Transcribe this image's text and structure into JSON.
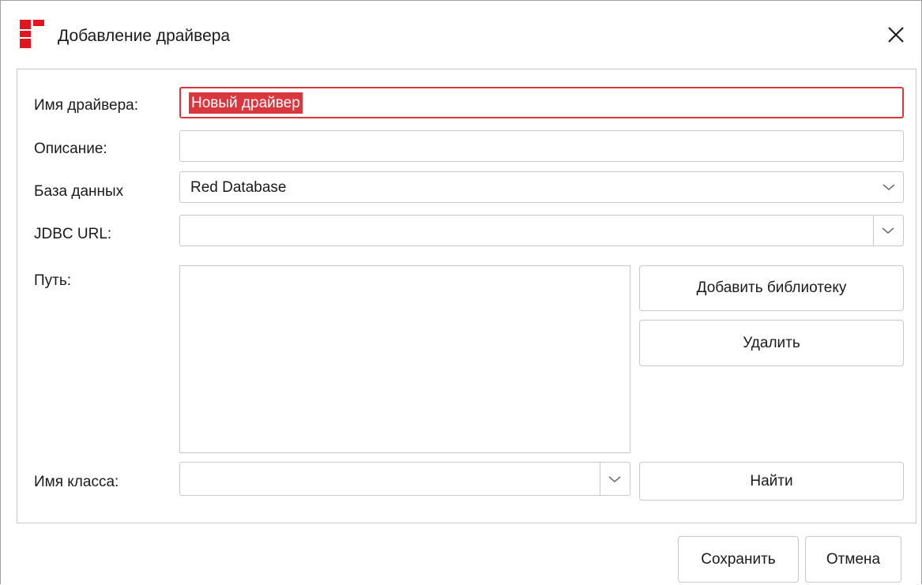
{
  "window": {
    "title": "Добавление драйвера",
    "accent_color": "#e3161f"
  },
  "form": {
    "driver_name": {
      "label": "Имя драйвера:",
      "value": "Новый драйвер"
    },
    "description": {
      "label": "Описание:",
      "value": ""
    },
    "database": {
      "label": "База данных",
      "selected": "Red Database"
    },
    "jdbc_url": {
      "label": "JDBC URL:",
      "value": ""
    },
    "path": {
      "label": "Путь:",
      "items": []
    },
    "class_name": {
      "label": "Имя класса:",
      "value": ""
    }
  },
  "buttons": {
    "add_library": "Добавить библиотеку",
    "delete": "Удалить",
    "find": "Найти",
    "save": "Сохранить",
    "cancel": "Отмена"
  }
}
